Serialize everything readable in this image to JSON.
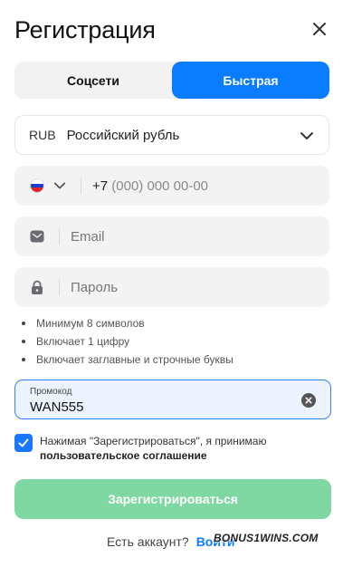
{
  "header": {
    "title": "Регистрация",
    "close_icon": "close-icon"
  },
  "tabs": [
    {
      "label": "Соцсети",
      "active": false
    },
    {
      "label": "Быстрая",
      "active": true
    }
  ],
  "currency": {
    "code": "RUB",
    "name": "Российский рубль"
  },
  "phone": {
    "prefix": "+7",
    "placeholder": "(000) 000 00-00",
    "flag": "russia-flag"
  },
  "email": {
    "placeholder": "Email"
  },
  "password": {
    "placeholder": "Пароль"
  },
  "password_rules": [
    "Минимум 8 символов",
    "Включает 1 цифру",
    "Включает заглавные и строчные буквы"
  ],
  "promo": {
    "label": "Промокод",
    "value": "WAN555"
  },
  "agreement": {
    "text": "Нажимая \"Зарегистрироваться\", я принимаю",
    "link": "пользовательское соглашение",
    "checked": true
  },
  "submit_label": "Зарегистрироваться",
  "login": {
    "question": "Есть аккаунт?",
    "link": "Войти"
  },
  "watermark": "BONUS1WINS.COM",
  "colors": {
    "accent": "#0a7cff",
    "submit": "#7fd7a2",
    "field_bg": "#f3f3f4"
  }
}
